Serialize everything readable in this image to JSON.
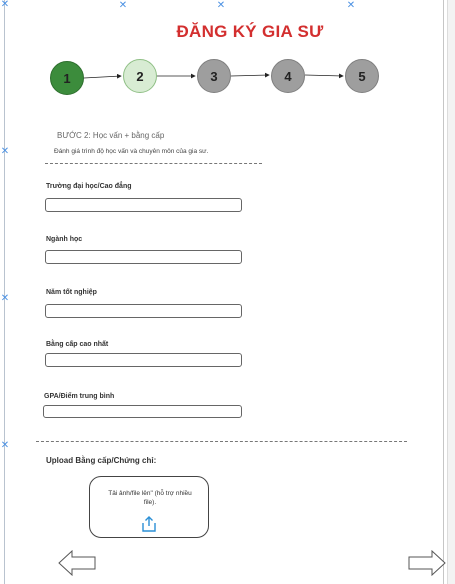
{
  "form": {
    "title": "ĐĂNG KÝ GIA SƯ",
    "steps": [
      "1",
      "2",
      "3",
      "4",
      "5"
    ],
    "current_step": 2,
    "step_title": "BƯỚC 2:  Học vấn + bằng cấp",
    "step_description": "Đánh giá trình độ học vấn và chuyên môn của gia sư.",
    "fields": [
      {
        "label": "Trường đại học/Cao đẳng",
        "value": ""
      },
      {
        "label": "Ngành học",
        "value": ""
      },
      {
        "label": "Năm tốt nghiệp",
        "value": ""
      },
      {
        "label": "Bằng cấp cao nhất",
        "value": ""
      },
      {
        "label": "GPA/Điểm trung bình",
        "value": ""
      }
    ],
    "upload": {
      "label": "Upload Bằng cấp/Chứng chỉ:",
      "box_text": "Tải ảnh/file lên\" (hỗ trợ nhiều file).",
      "icon": "upload-icon"
    },
    "navigation": {
      "prev_icon": "arrow-left-icon",
      "next_icon": "arrow-right-icon"
    }
  },
  "colors": {
    "title": "#d32f2f",
    "step_done": "#3c8c3c",
    "step_current": "#d8ecd3",
    "step_pending": "#9e9e9e",
    "upload_icon": "#2a8fd6",
    "frame_marker": "#4a90e2"
  }
}
